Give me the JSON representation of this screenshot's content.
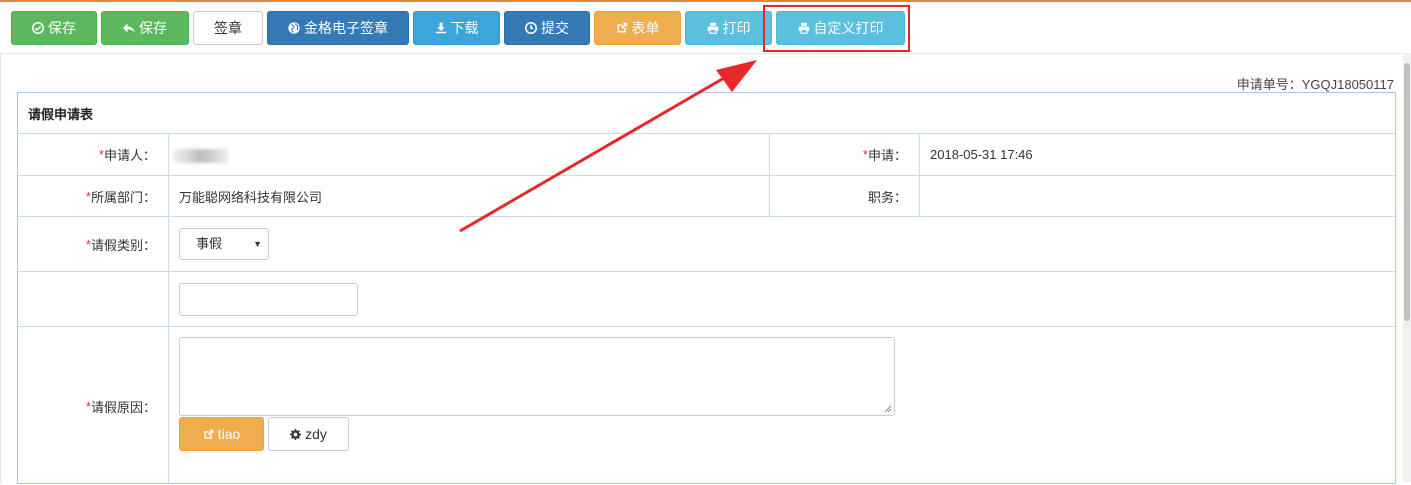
{
  "toolbar": {
    "buttons": [
      {
        "label": "保存",
        "icon": "check-circle-icon"
      },
      {
        "label": "保存",
        "icon": "reply-icon"
      },
      {
        "label": "签章",
        "icon": ""
      },
      {
        "label": "金格电子签章",
        "icon": "globe-icon"
      },
      {
        "label": "下载",
        "icon": "download-icon"
      },
      {
        "label": "提交",
        "icon": "clock-icon"
      },
      {
        "label": "表单",
        "icon": "external-link-icon"
      },
      {
        "label": "打印",
        "icon": "printer-icon"
      },
      {
        "label": "自定义打印",
        "icon": "printer-icon"
      }
    ]
  },
  "request_number": "申请单号：YGQJ18050117",
  "form": {
    "title": "请假申请表",
    "applicant_label": "申请人：",
    "apply_time_label": "申请：",
    "apply_time_value": "2018-05-31 17:46",
    "department_label": "所属部门：",
    "department_value": "万能聪网络科技有限公司",
    "position_label": "职务：",
    "leave_type_label": "请假类别：",
    "leave_type_value": "事假",
    "leave_reason_label": "请假原因：",
    "required_mark": "*",
    "tiao_button": "tiao",
    "zdy_button": "zdy"
  },
  "colors": {
    "annotation_red": "#e62828",
    "top_border": "#e8852f",
    "table_border": "#a9c8e6"
  }
}
